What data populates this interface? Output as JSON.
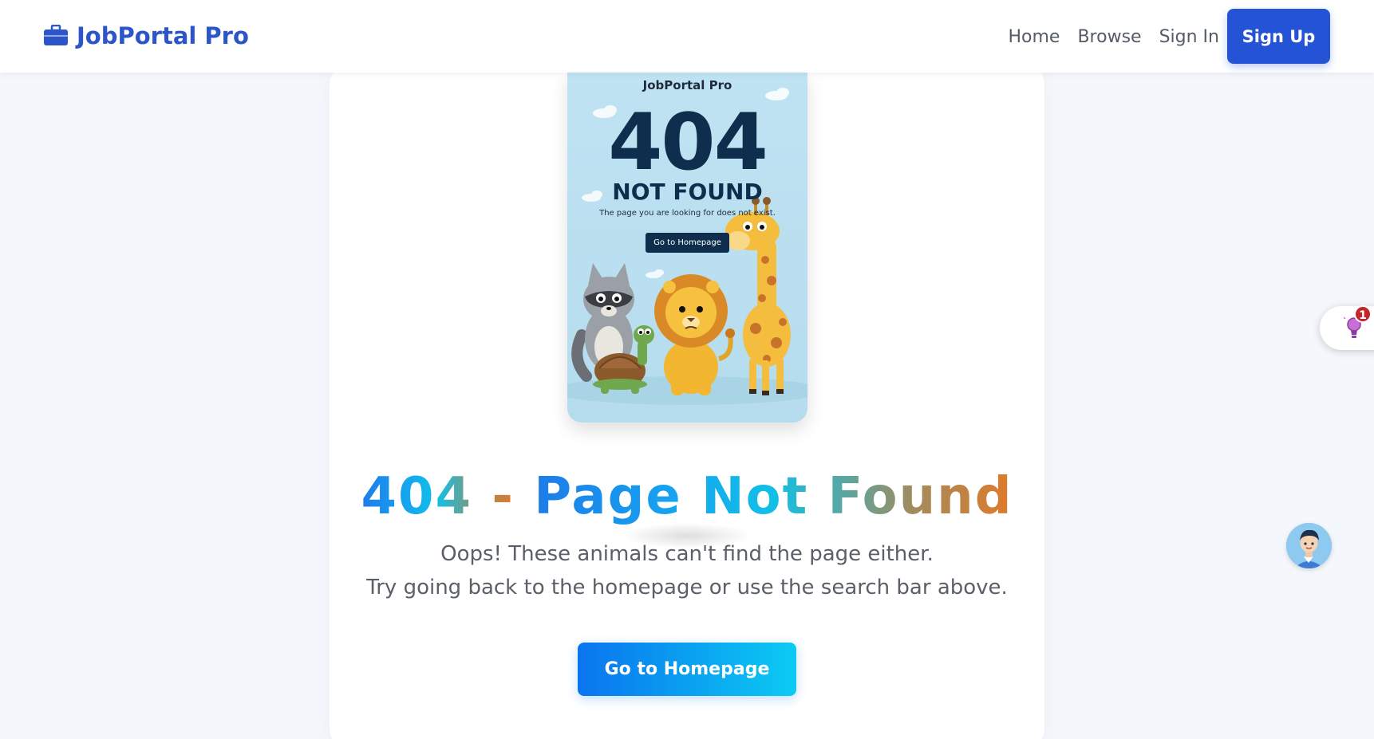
{
  "nav": {
    "brand": "JobPortal Pro",
    "links": [
      "Home",
      "Browse",
      "Sign In"
    ],
    "signup": "Sign Up",
    "brand_color": "#2b55c9",
    "signup_color": "#2553d6"
  },
  "illustration": {
    "brand": "JobPortal Pro",
    "code": "404",
    "title": "NOT FOUND",
    "subtitle": "The page you are looking for does not exist.",
    "button": "Go to Homepage",
    "animals": [
      "raccoon",
      "turtle",
      "lion",
      "giraffe"
    ]
  },
  "main": {
    "headline_code": "404 -",
    "headline_rest": "Page Not Found",
    "line1": "Oops! These animals can't find the page either.",
    "line2": "Try going back to the homepage or use the search bar above.",
    "button": "Go to Homepage"
  },
  "widgets": {
    "badge_count": "1",
    "side_icon": "lightbulb-icon",
    "chat_icon": "support-agent-avatar"
  }
}
